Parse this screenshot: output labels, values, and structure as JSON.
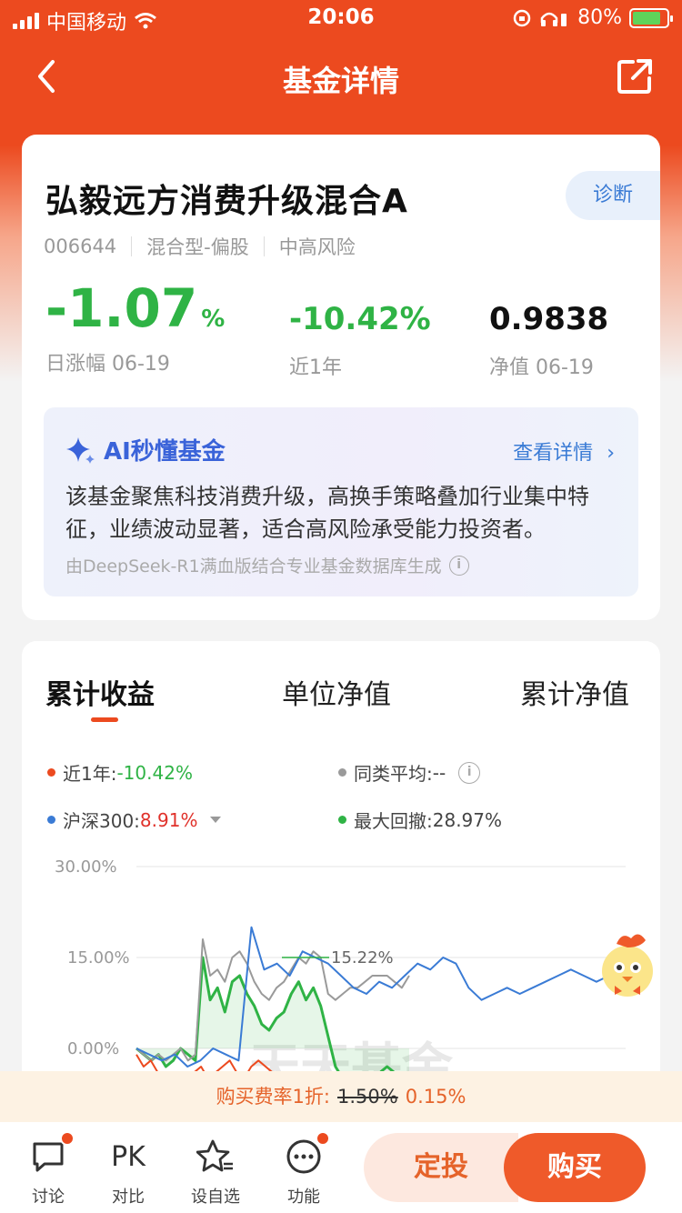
{
  "status_bar": {
    "carrier": "中国移动",
    "time": "20:06",
    "battery": "80%"
  },
  "nav": {
    "title": "基金详情"
  },
  "fund": {
    "name": "弘毅远方消费升级混合A",
    "code": "006644",
    "type": "混合型-偏股",
    "risk": "中高风险",
    "diagnose_label": "诊断",
    "daily_change": "-1.07",
    "daily_change_unit": "%",
    "daily_change_label": "日涨幅 06-19",
    "year_change": "-10.42%",
    "year_change_label": "近1年",
    "nav_value": "0.9838",
    "nav_label": "净值 06-19"
  },
  "ai": {
    "title": "AI秒懂基金",
    "link": "查看详情",
    "summary": "该基金聚焦科技消费升级，高换手策略叠加行业集中特征，业绩波动显著，适合高风险承受能力投资者。",
    "footnote": "由DeepSeek-R1满血版结合专业基金数据库生成"
  },
  "chart_tabs": [
    "累计收益",
    "单位净值",
    "累计净值"
  ],
  "legend": {
    "fund_label": "近1年:",
    "fund_value": "-10.42%",
    "peer_label": "同类平均:",
    "peer_value": "--",
    "index_label": "沪深300:",
    "index_value": "8.91%",
    "drawdown_label": "最大回撤:",
    "drawdown_value": "28.97%"
  },
  "colors": {
    "fund": "#ec4a1f",
    "peer": "#9a9a9a",
    "index": "#3a7bd5",
    "drawdown": "#2fb345"
  },
  "chart_data": {
    "type": "line",
    "yticks": [
      "30.00%",
      "15.00%",
      "0.00%"
    ],
    "ylim": [
      -5,
      30
    ],
    "annotation": "15.22%",
    "watermark": "天天基金",
    "series": [
      {
        "name": "近1年",
        "values": [
          -1,
          -3,
          -2,
          -4,
          -5,
          -4,
          -6,
          -5,
          -4,
          -3,
          -5,
          -4,
          -3,
          -2,
          -4,
          -5,
          -3,
          -2,
          -3,
          -4
        ]
      },
      {
        "name": "沪深300",
        "values": [
          0,
          -1,
          -2,
          -1,
          -3,
          -2,
          0,
          -1,
          -2,
          20,
          13,
          14,
          12,
          16,
          15,
          14,
          12,
          10,
          9,
          11,
          10,
          12,
          14,
          13,
          15,
          14,
          10,
          8,
          9,
          10,
          9,
          10,
          11,
          12,
          13,
          12,
          11,
          12
        ]
      },
      {
        "name": "同类平均",
        "values": [
          0,
          -1,
          -2,
          -1,
          -2,
          -1,
          0,
          -2,
          -1,
          18,
          12,
          13,
          11,
          15,
          16,
          14,
          11,
          9,
          8,
          10,
          11,
          13,
          15,
          14,
          16,
          15,
          9,
          8,
          9,
          10,
          10,
          11,
          12,
          12,
          12,
          11,
          10,
          12
        ]
      },
      {
        "name": "最大回撤",
        "values": [
          0,
          -1,
          -2,
          -1,
          -3,
          -2,
          0,
          -1,
          -2,
          15,
          8,
          10,
          6,
          11,
          12,
          9,
          7,
          4,
          3,
          5,
          6,
          9,
          11,
          8,
          10,
          7,
          2,
          -3,
          -5,
          -6,
          -5,
          -4,
          -5,
          -4,
          -3,
          -4,
          -5,
          -6
        ]
      }
    ]
  },
  "fee": {
    "label": "购买费率1折:",
    "old_rate": "1.50%",
    "new_rate": "0.15%"
  },
  "bottom_bar": {
    "discuss": "讨论",
    "pk_text": "PK",
    "compare": "对比",
    "watchlist": "设自选",
    "functions": "功能",
    "sip": "定投",
    "buy": "购买"
  }
}
